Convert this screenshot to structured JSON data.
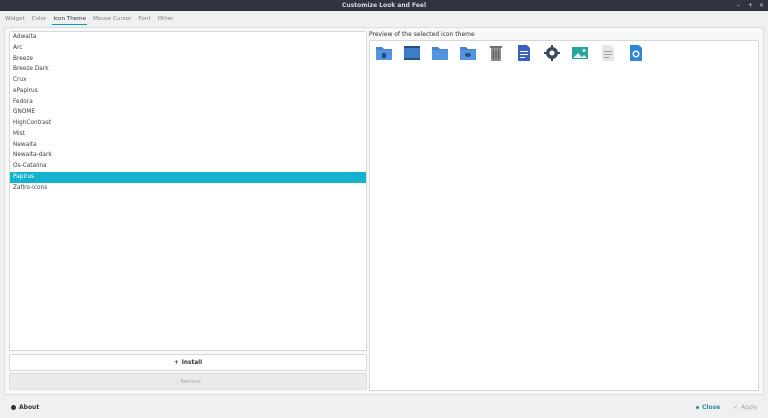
{
  "window": {
    "title": "Customize Look and Feel",
    "controls": {
      "minimize": "–",
      "maximize": "+",
      "close": "×"
    }
  },
  "tabs": [
    {
      "label": "Widget",
      "active": false
    },
    {
      "label": "Color",
      "active": false
    },
    {
      "label": "Icon Theme",
      "active": true
    },
    {
      "label": "Mouse Cursor",
      "active": false
    },
    {
      "label": "Font",
      "active": false
    },
    {
      "label": "Other",
      "active": false
    }
  ],
  "themes": {
    "items": [
      "Adwaita",
      "Arc",
      "Breeze",
      "Breeze Dark",
      "Crux",
      "ePapirus",
      "Fedora",
      "GNOME",
      "HighContrast",
      "Mist",
      "Newaita",
      "Newaita-dark",
      "Os-Catalina",
      "Papirus",
      "Zafiro-icons"
    ],
    "selected_index": 13
  },
  "buttons": {
    "install": "Install",
    "remove": "Remove"
  },
  "preview": {
    "label": "Preview of the selected icon theme",
    "icons": [
      "folder-home-icon",
      "desktop-icon",
      "folder-icon",
      "folder-remote-icon",
      "trash-icon",
      "document-icon",
      "settings-icon",
      "image-icon",
      "text-file-icon",
      "web-browser-icon"
    ]
  },
  "footer": {
    "about": "About",
    "close": "Close",
    "apply": "Apply"
  },
  "colors": {
    "accent": "#14b2cf",
    "folder": "#5294e2",
    "titlebar": "#2f343f"
  }
}
